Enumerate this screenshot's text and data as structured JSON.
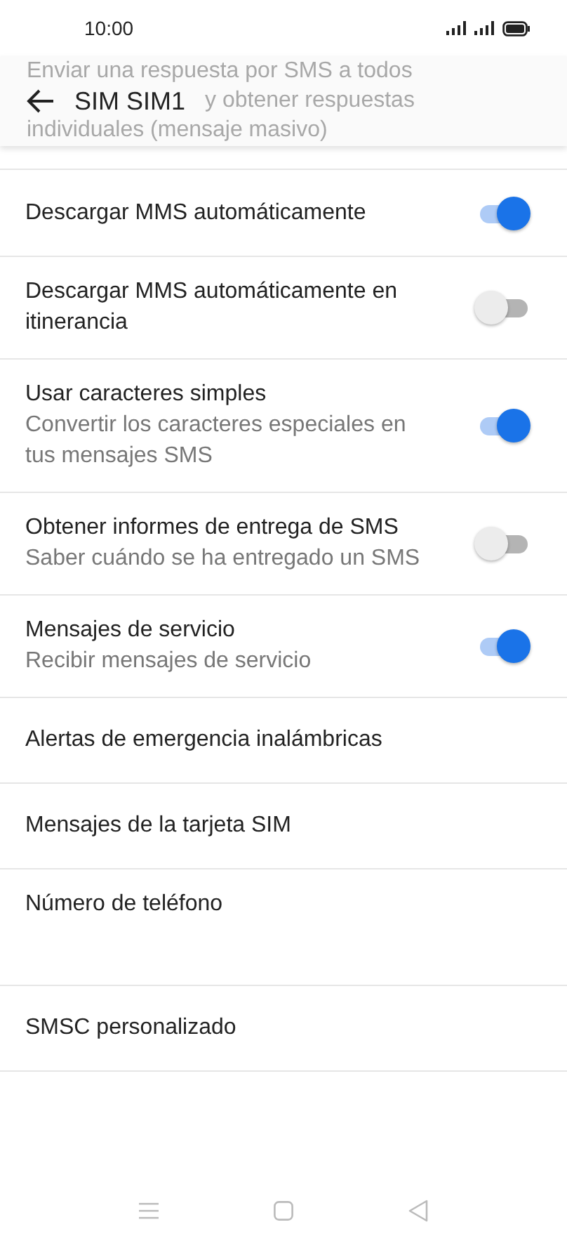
{
  "status_bar": {
    "time": "10:00"
  },
  "header": {
    "title": "SIM SIM1",
    "scrolled_text": [
      "Enviar una respuesta por SMS a todos",
      "y obtener respuestas",
      "individuales (mensaje masivo)"
    ]
  },
  "settings": [
    {
      "kind": "toggle",
      "title": "Descargar MMS automáticamente",
      "on": true
    },
    {
      "kind": "toggle",
      "title": "Descargar MMS automáticamente en itinerancia",
      "on": false
    },
    {
      "kind": "toggle",
      "title": "Usar caracteres simples",
      "subtitle": "Convertir los caracteres especiales en tus mensajes SMS",
      "on": true
    },
    {
      "kind": "toggle",
      "title": "Obtener informes de entrega de SMS",
      "subtitle": "Saber cuándo se ha entregado un SMS",
      "on": false
    },
    {
      "kind": "toggle",
      "title": "Mensajes de servicio",
      "subtitle": "Recibir mensajes de servicio",
      "on": true
    },
    {
      "kind": "link",
      "title": "Alertas de emergencia inalámbricas"
    },
    {
      "kind": "link",
      "title": "Mensajes de la tarjeta SIM"
    },
    {
      "kind": "tall",
      "title": "Número de teléfono"
    },
    {
      "kind": "link",
      "title": "SMSC personalizado"
    }
  ]
}
